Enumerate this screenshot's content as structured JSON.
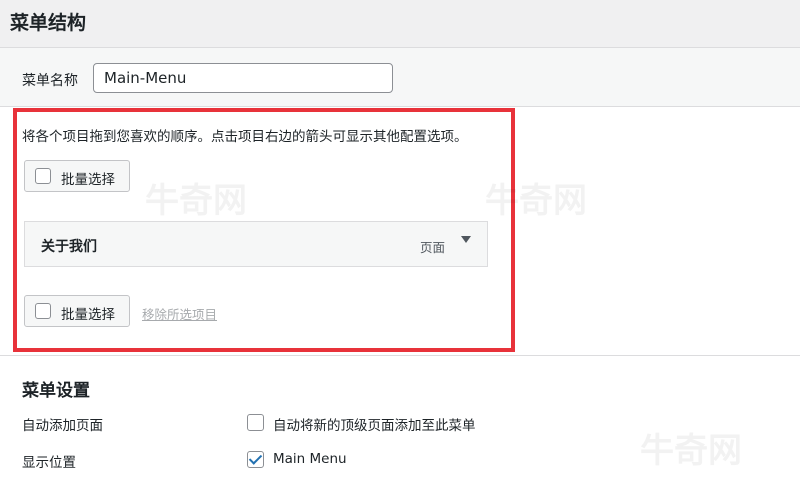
{
  "section_title": "菜单结构",
  "menu_name": {
    "label": "菜单名称",
    "value": "Main-Menu"
  },
  "instructions": "将各个项目拖到您喜欢的顺序。点击项目右边的箭头可显示其他配置选项。",
  "bulk_select_label": "批量选择",
  "menu_items": [
    {
      "title": "关于我们",
      "type": "页面"
    }
  ],
  "remove_selected_label": "移除所选项目",
  "settings": {
    "title": "菜单设置",
    "auto_add": {
      "label": "自动添加页面",
      "option": "自动将新的顶级页面添加至此菜单",
      "checked": false
    },
    "locations": {
      "label": "显示位置",
      "option": "Main Menu",
      "checked": true
    }
  },
  "watermark": "牛奇网",
  "colors": {
    "highlight_border": "#e8323a",
    "accent": "#2271b1"
  }
}
